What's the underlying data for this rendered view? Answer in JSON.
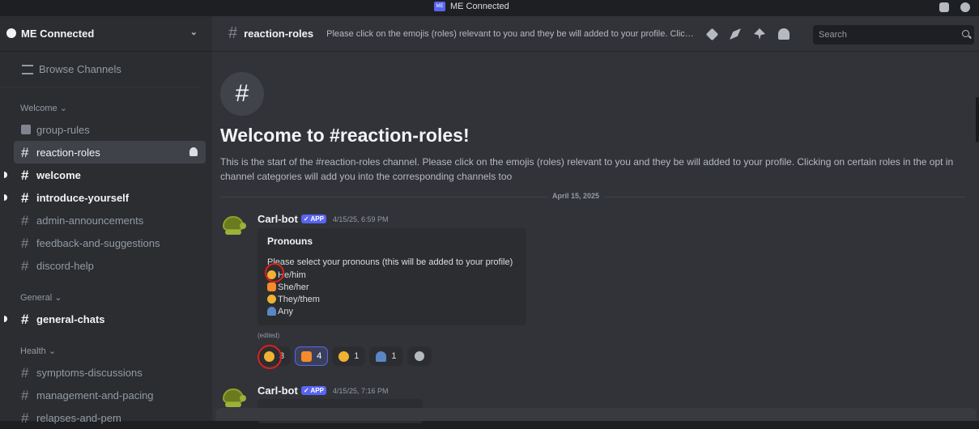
{
  "window": {
    "title": "ME Connected",
    "logo_text": "ME"
  },
  "server": {
    "name": "ME Connected"
  },
  "sidebar": {
    "browse_label": "Browse Channels",
    "categories": [
      {
        "name": "Welcome ⌄",
        "channels": [
          "group-rules",
          "reaction-roles",
          "welcome",
          "introduce-yourself",
          "admin-announcements",
          "feedback-and-suggestions",
          "discord-help"
        ]
      },
      {
        "name": "General ⌄",
        "channels": [
          "general-chats"
        ]
      },
      {
        "name": "Health ⌄",
        "channels": [
          "symptoms-discussions",
          "management-and-pacing",
          "relapses-and-pem"
        ]
      }
    ]
  },
  "header": {
    "channel_name": "reaction-roles",
    "topic": "Please click on the emojis (roles) relevant to you and they be will added to your profile. Clicking on certain roles in the opt in channel categories will add you into the corresponding channels too",
    "search_placeholder": "Search"
  },
  "welcome": {
    "hash": "#",
    "title": "Welcome to #reaction-roles!",
    "description": "This is the start of the #reaction-roles channel. Please click on the emojis (roles) relevant to you and they be will added to your profile. Clicking on certain roles in the opt in channel categories will add you into the corresponding channels too"
  },
  "date_divider": "April 15, 2025",
  "messages": [
    {
      "author": "Carl-bot",
      "badge": "✓ APP",
      "timestamp": "4/15/25, 6:59 PM",
      "embed": {
        "title": "Pronouns",
        "description": "Please select your pronouns (this will be added to your profile)",
        "options": [
          "He/him",
          "She/her",
          "They/them",
          "Any"
        ]
      },
      "edited": "(edited)",
      "reactions": [
        {
          "emoji": "man-emoji",
          "count": "3",
          "me": false
        },
        {
          "emoji": "woman-emoji",
          "count": "4",
          "me": true
        },
        {
          "emoji": "person-emoji",
          "count": "1",
          "me": false
        },
        {
          "emoji": "silhouette-emoji",
          "count": "1",
          "me": false
        }
      ]
    },
    {
      "author": "Carl-bot",
      "badge": "✓ APP",
      "timestamp": "4/15/25, 7:16 PM"
    }
  ],
  "colors": {
    "accent": "#5865f2",
    "highlight": "#e0201b"
  }
}
